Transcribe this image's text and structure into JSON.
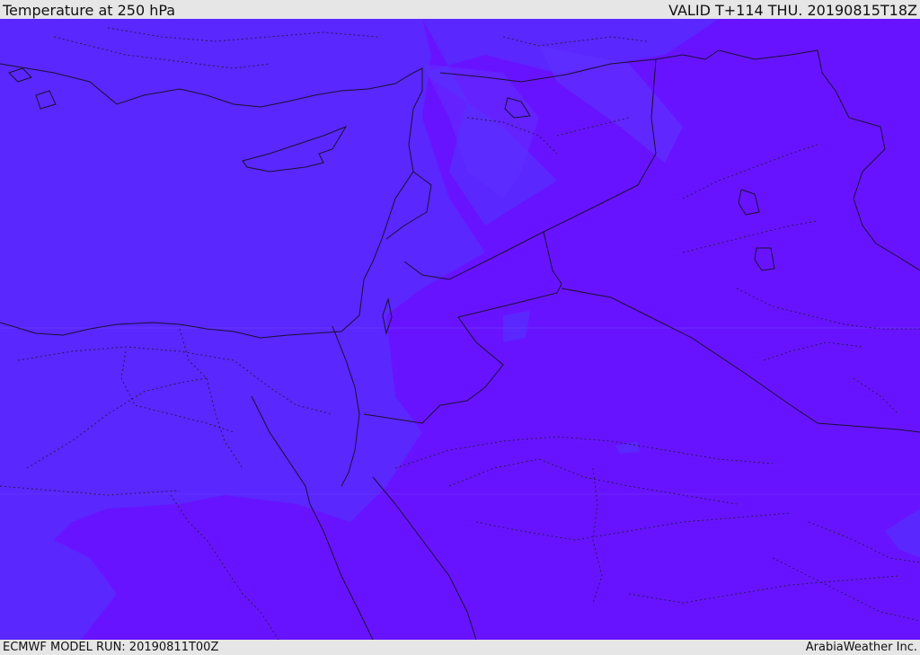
{
  "header": {
    "title": "Temperature at 250 hPa",
    "valid": "VALID T+114 THU. 20190815T18Z"
  },
  "footer": {
    "model_run": "ECMWF MODEL RUN: 20190811T00Z",
    "credit": "ArabiaWeather Inc."
  },
  "map": {
    "colors": {
      "cooler_band": "#5a27ff",
      "warmer_band": "#6813ff",
      "land_water_tint": "#5d2cff",
      "borders": "#1a1030"
    }
  }
}
